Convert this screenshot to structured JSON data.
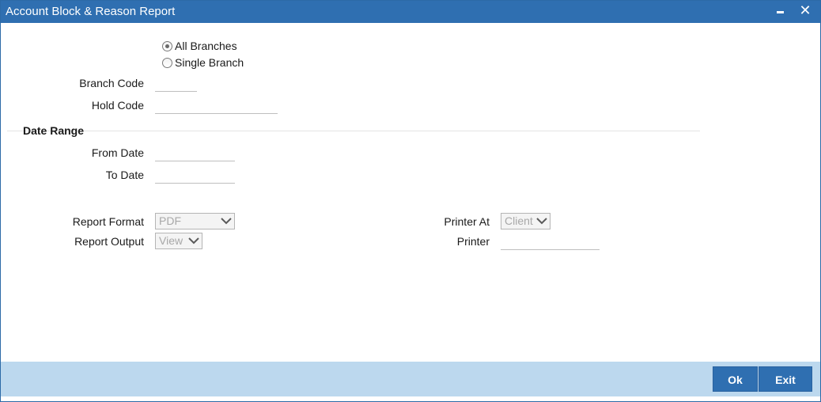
{
  "window": {
    "title": "Account Block & Reason Report",
    "minimize_glyph": "",
    "close_glyph": "✕"
  },
  "branch_selection": {
    "options": [
      {
        "label": "All Branches",
        "checked": true
      },
      {
        "label": "Single Branch",
        "checked": false
      }
    ]
  },
  "fields": {
    "branch_code_label": "Branch Code",
    "branch_code_value": "",
    "hold_code_label": "Hold Code",
    "hold_code_value": ""
  },
  "date_range": {
    "title": "Date Range",
    "from_label": "From Date",
    "from_value": "",
    "to_label": "To Date",
    "to_value": ""
  },
  "report": {
    "format_label": "Report Format",
    "format_value": "PDF",
    "output_label": "Report Output",
    "output_value": "View",
    "printer_at_label": "Printer At",
    "printer_at_value": "Client",
    "printer_label": "Printer",
    "printer_value": ""
  },
  "footer": {
    "ok_label": "Ok",
    "exit_label": "Exit"
  },
  "colors": {
    "titlebar": "#2f6fb1",
    "footer": "#bcd8ee",
    "button": "#2f6fb1"
  }
}
